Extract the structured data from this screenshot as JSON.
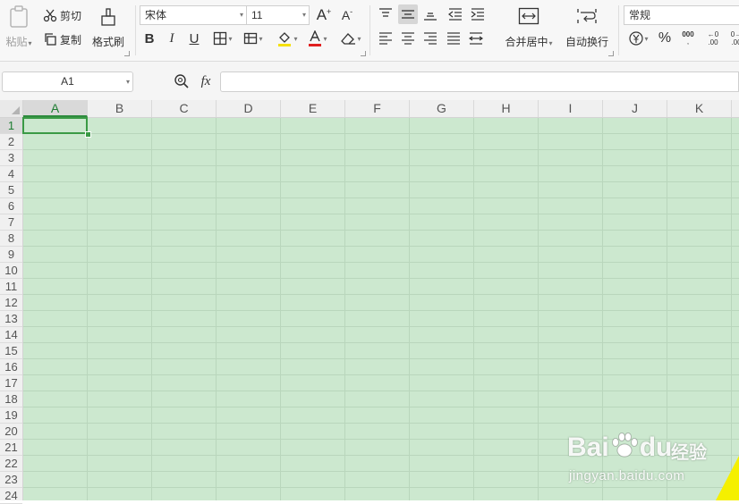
{
  "clipboard": {
    "paste_label": "粘贴",
    "cut_label": "剪切",
    "copy_label": "复制",
    "format_painter_label": "格式刷"
  },
  "font": {
    "name": "宋体",
    "size": "11",
    "bold": "B",
    "italic": "I",
    "underline": "U",
    "grow": "A",
    "shrink": "A"
  },
  "alignment": {
    "merge_center_label": "合并居中",
    "wrap_text_label": "自动换行"
  },
  "number": {
    "format": "常规",
    "percent": "%",
    "thousands": "000",
    "inc_decimal": ".00",
    "dec_decimal": ".00"
  },
  "formula_bar": {
    "name_box": "A1",
    "fx_label": "fx",
    "formula_value": ""
  },
  "sheet": {
    "columns": [
      "A",
      "B",
      "C",
      "D",
      "E",
      "F",
      "G",
      "H",
      "I",
      "J",
      "K"
    ],
    "rows": [
      "1",
      "2",
      "3",
      "4",
      "5",
      "6",
      "7",
      "8",
      "9",
      "10",
      "11",
      "12",
      "13",
      "14",
      "15",
      "16",
      "17",
      "18",
      "19",
      "20",
      "21",
      "22",
      "23",
      "24"
    ],
    "active_cell": "A1"
  },
  "watermark": {
    "logo_text": "Bai",
    "logo_text2": "du",
    "cn_text": "经验",
    "url": "jingyan.baidu.com"
  },
  "colors": {
    "sheet_bg": "#cce8cf",
    "selection": "#3a9a45",
    "font_color_bar": "#e02020",
    "highlight_bar": "#f5e000",
    "yellow_corner": "#f5f000"
  }
}
